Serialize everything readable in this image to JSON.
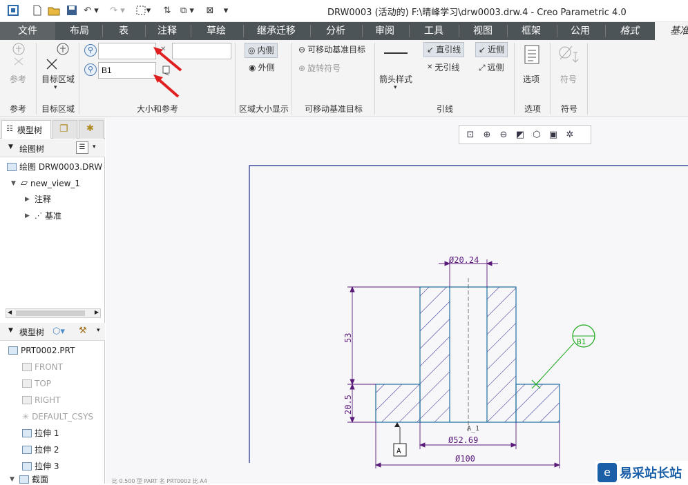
{
  "window": {
    "title": "DRW0003 (活动的) F:\\晴峰学习\\drw0003.drw.4 - Creo Parametric 4.0"
  },
  "tabs": [
    {
      "label": "文件"
    },
    {
      "label": "布局"
    },
    {
      "label": "表"
    },
    {
      "label": "注释"
    },
    {
      "label": "草绘"
    },
    {
      "label": "继承迁移"
    },
    {
      "label": "分析"
    },
    {
      "label": "审阅"
    },
    {
      "label": "工具"
    },
    {
      "label": "视图"
    },
    {
      "label": "框架"
    },
    {
      "label": "公用"
    },
    {
      "label": "格式"
    },
    {
      "label": "基准"
    }
  ],
  "ribbon": {
    "ref": {
      "button": "参考",
      "group": "参考"
    },
    "target": {
      "button": "目标区域",
      "group": "目标区域"
    },
    "size": {
      "group": "大小和参考",
      "field1_value": "",
      "field2_value": "B1",
      "field3_value": ""
    },
    "area": {
      "inner": "内侧",
      "outer": "外侧",
      "group": "区域大小显示"
    },
    "movable": {
      "movable_target": "可移动基准目标",
      "rotate_symbol": "旋转符号",
      "group": "可移动基准目标"
    },
    "leader": {
      "arrow_style": "箭头样式",
      "straight": "直引线",
      "none": "无引线",
      "near": "近侧",
      "far": "远侧",
      "group": "引线"
    },
    "options": {
      "button": "选项",
      "group": "选项"
    },
    "symbol": {
      "button": "符号",
      "group": "符号"
    }
  },
  "left_panel": {
    "nav_tab": "模型树",
    "drawing_tree": {
      "header": "绘图树",
      "items": [
        "绘图 DRW0003.DRW",
        "new_view_1",
        "注释",
        "基准"
      ]
    },
    "model_tree": {
      "header": "模型树",
      "items": [
        "PRT0002.PRT",
        "FRONT",
        "TOP",
        "RIGHT",
        "DEFAULT_CSYS",
        "拉伸 1",
        "拉伸 2",
        "拉伸 3",
        "截面"
      ]
    }
  },
  "drawing": {
    "dims": {
      "top_dia": "Ø20.24",
      "height_upper": "53",
      "height_lower": "20.5",
      "mid_dia": "Ø52.69",
      "bottom_dia": "Ø100"
    },
    "datum_a": "A",
    "target_label": "B1",
    "section_label": "A_1"
  },
  "status": {
    "text": "比 0.500  型 PART  名 PRT0002  比 A4"
  },
  "watermark": {
    "text": "易采站长站"
  },
  "colors": {
    "dimension": "#5a1a7a",
    "part_outline": "#1f6fa0",
    "target": "#1aa81a",
    "arrow_annotation": "#e02020"
  }
}
